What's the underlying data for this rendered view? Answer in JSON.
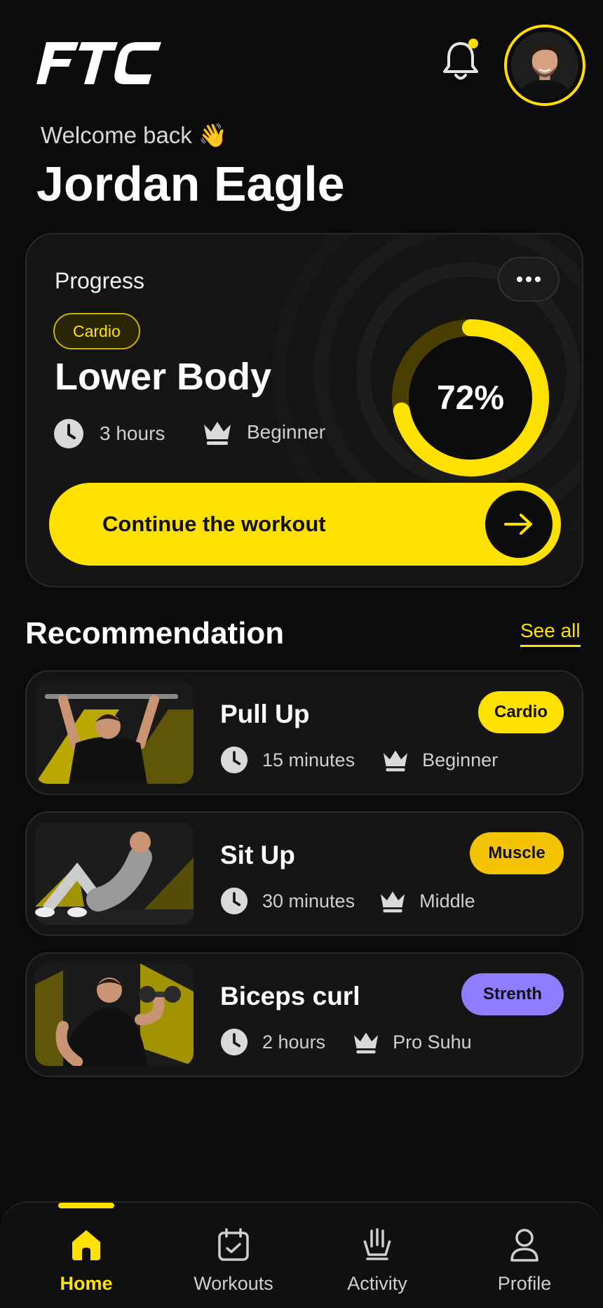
{
  "header": {
    "logo_text": "FTC",
    "notification_dot_color": "#ffdd00"
  },
  "greeting": {
    "welcome": "Welcome back 👋",
    "name": "Jordan Eagle"
  },
  "progress": {
    "title": "Progress",
    "tag": "Cardio",
    "workout": "Lower Body",
    "duration": "3 hours",
    "level": "Beginner",
    "percent": 72,
    "percent_label": "72%",
    "cta_label": "Continue the workout"
  },
  "recommendation": {
    "title": "Recommendation",
    "see_all": "See all",
    "items": [
      {
        "name": "Pull Up",
        "duration": "15 minutes",
        "level": "Beginner",
        "tag": "Cardio",
        "tag_color": "#ffe100"
      },
      {
        "name": "Sit Up",
        "duration": "30 minutes",
        "level": "Middle",
        "tag": "Muscle",
        "tag_color": "#f5c400"
      },
      {
        "name": "Biceps curl",
        "duration": "2 hours",
        "level": "Pro Suhu",
        "tag": "Strenth",
        "tag_color": "#8f7dff"
      }
    ]
  },
  "nav": {
    "items": [
      {
        "label": "Home",
        "active": true
      },
      {
        "label": "Workouts",
        "active": false
      },
      {
        "label": "Activity",
        "active": false
      },
      {
        "label": "Profile",
        "active": false
      }
    ]
  },
  "colors": {
    "accent": "#ffe100",
    "background": "#0b0b0c",
    "card": "#151515"
  }
}
